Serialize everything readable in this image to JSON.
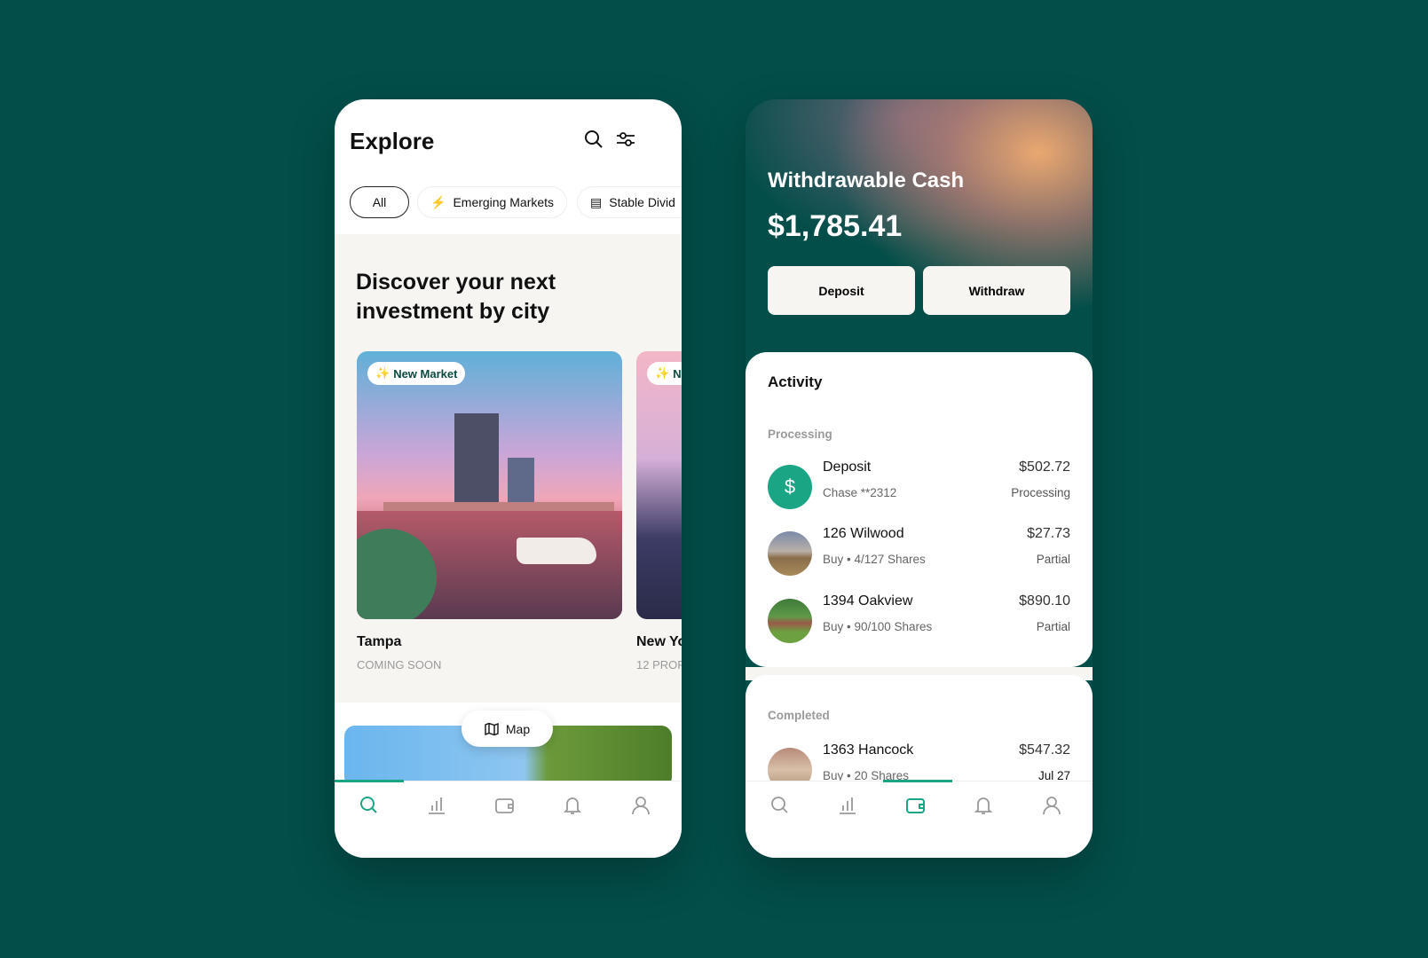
{
  "explore": {
    "title": "Explore",
    "filters": [
      {
        "label": "All",
        "active": true
      },
      {
        "label": "Emerging Markets",
        "icon": "sparkle-chart-icon"
      },
      {
        "label": "Stable Divid",
        "icon": "cash-icon"
      }
    ],
    "headline": "Discover your next investment by city",
    "cards": [
      {
        "badge": "New Market",
        "city": "Tampa",
        "status": "COMING SOON"
      },
      {
        "badge": "Ne",
        "city": "New Yo",
        "status": "12 PROP"
      }
    ],
    "map_label": "Map",
    "active_tab": "search"
  },
  "wallet": {
    "title": "Withdrawable Cash",
    "amount": "$1,785.41",
    "deposit_label": "Deposit",
    "withdraw_label": "Withdraw",
    "activity_title": "Activity",
    "processing_label": "Processing",
    "processing": [
      {
        "name": "Deposit",
        "detail": "Chase **2312",
        "amount": "$502.72",
        "status": "Processing",
        "icon": "dollar-icon"
      },
      {
        "name": "126 Wilwood",
        "detail": "Buy • 4/127 Shares",
        "amount": "$27.73",
        "status": "Partial"
      },
      {
        "name": "1394 Oakview",
        "detail": "Buy • 90/100 Shares",
        "amount": "$890.10",
        "status": "Partial"
      }
    ],
    "completed_label": "Completed",
    "completed": [
      {
        "name": "1363 Hancock",
        "detail": "Buy • 20 Shares",
        "amount": "$547.32",
        "status": "Jul 27"
      }
    ],
    "active_tab": "wallet"
  },
  "colors": {
    "background": "#034e49",
    "accent": "#1aa585",
    "beige": "#f6f5f1"
  }
}
